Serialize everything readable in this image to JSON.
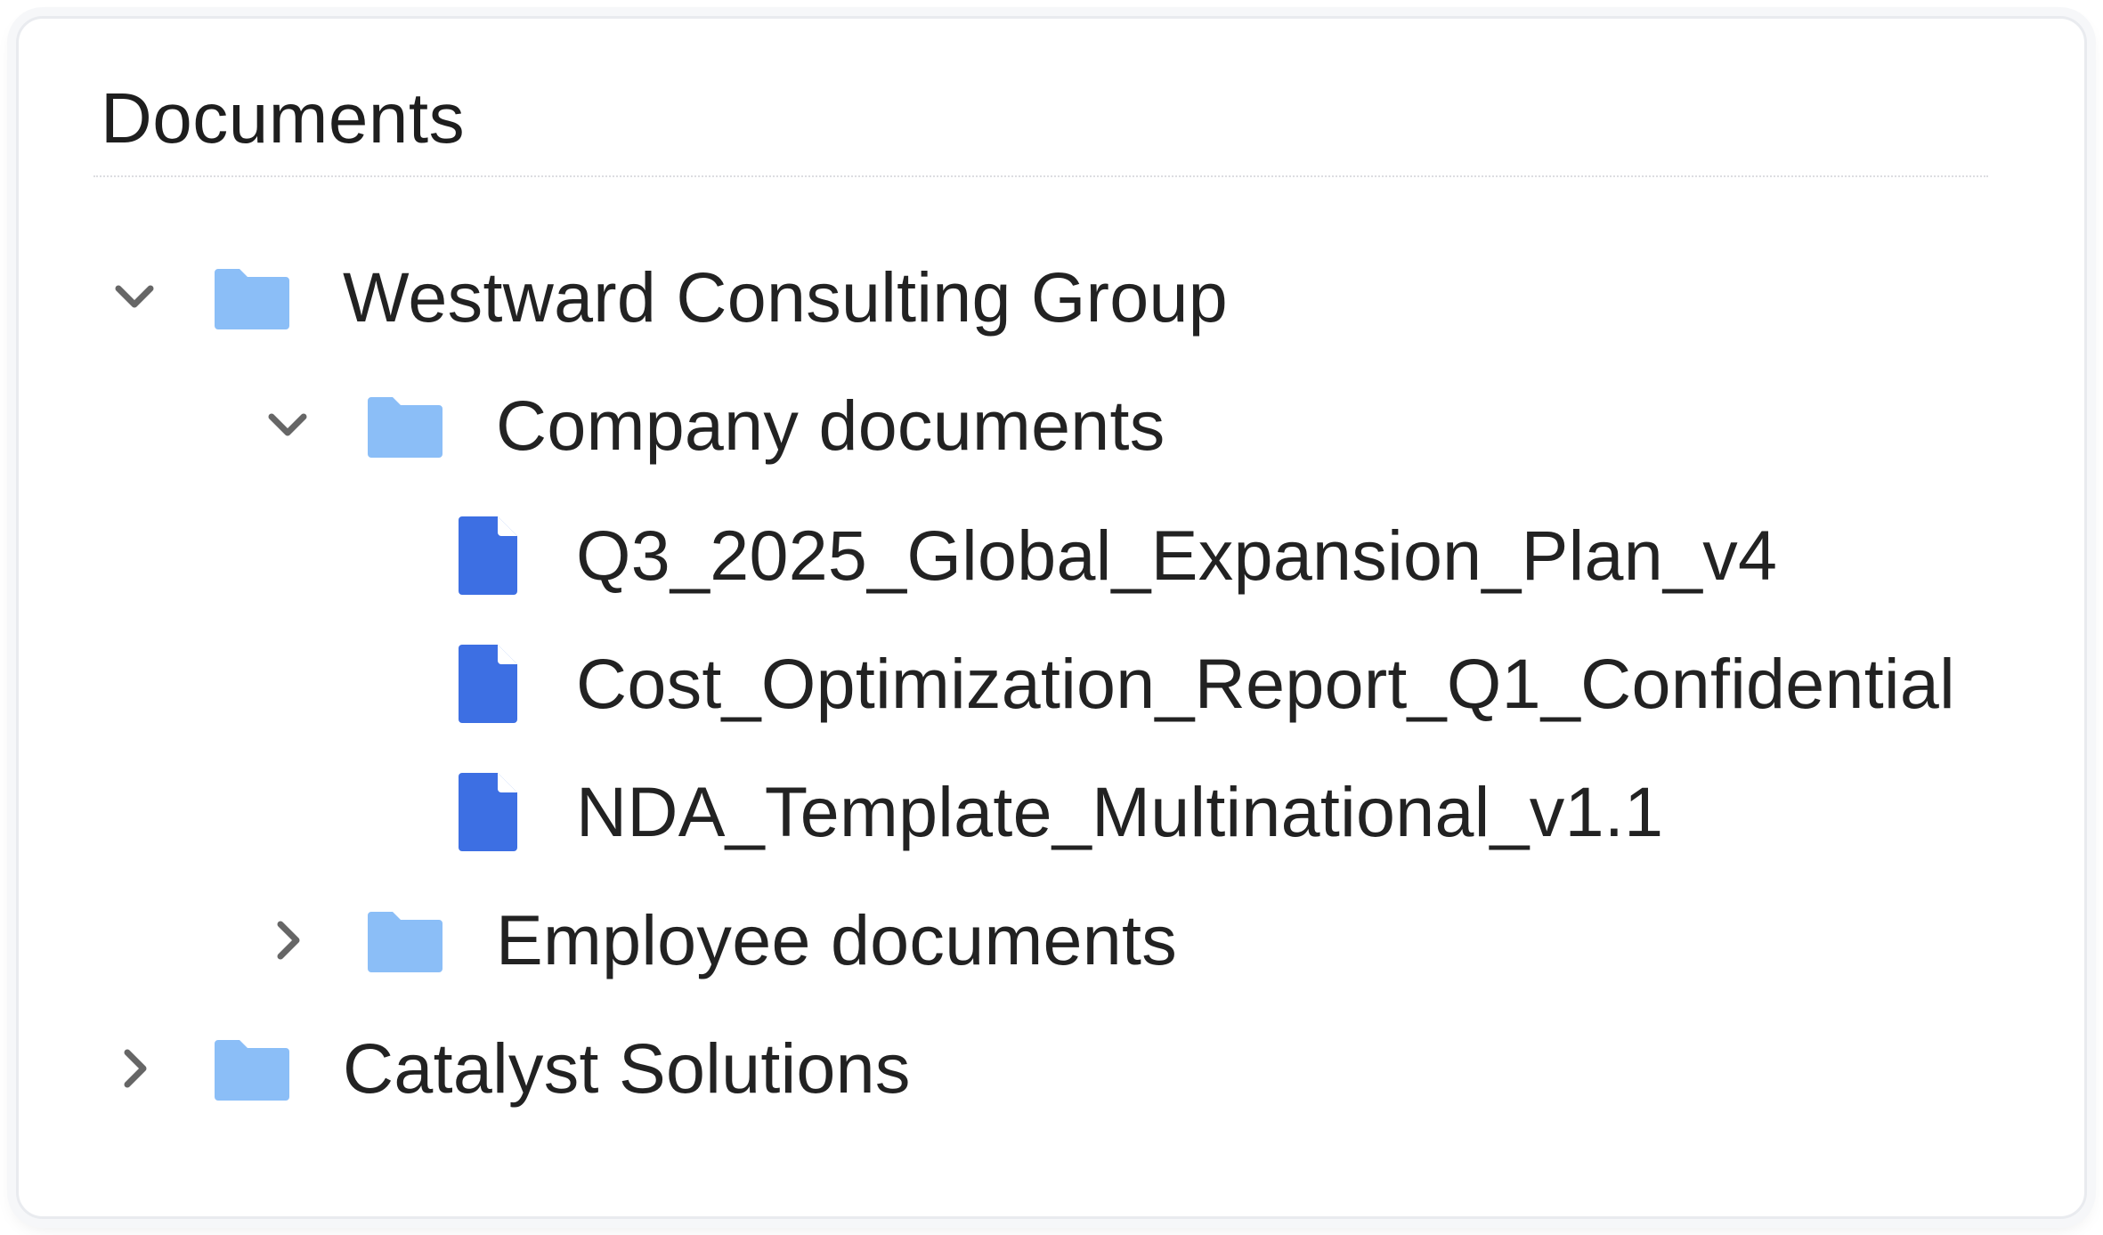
{
  "panel": {
    "title": "Documents"
  },
  "tree": {
    "root_1": {
      "label": "Westward Consulting Group",
      "expanded": true,
      "icon": "folder-icon",
      "children": {
        "company": {
          "label": "Company documents",
          "expanded": true,
          "icon": "folder-icon",
          "files": [
            {
              "label": "Q3_2025_Global_Expansion_Plan_v4",
              "icon": "file-icon"
            },
            {
              "label": "Cost_Optimization_Report_Q1_Confidential",
              "icon": "file-icon"
            },
            {
              "label": "NDA_Template_Multinational_v1.1",
              "icon": "file-icon"
            }
          ]
        },
        "employee": {
          "label": "Employee documents",
          "expanded": false,
          "icon": "folder-icon"
        }
      }
    },
    "root_2": {
      "label": "Catalyst Solutions",
      "expanded": false,
      "icon": "folder-icon"
    }
  },
  "colors": {
    "folder": "#8bbef7",
    "file": "#3d6fe3",
    "chevron": "#666666",
    "text": "#222222"
  }
}
